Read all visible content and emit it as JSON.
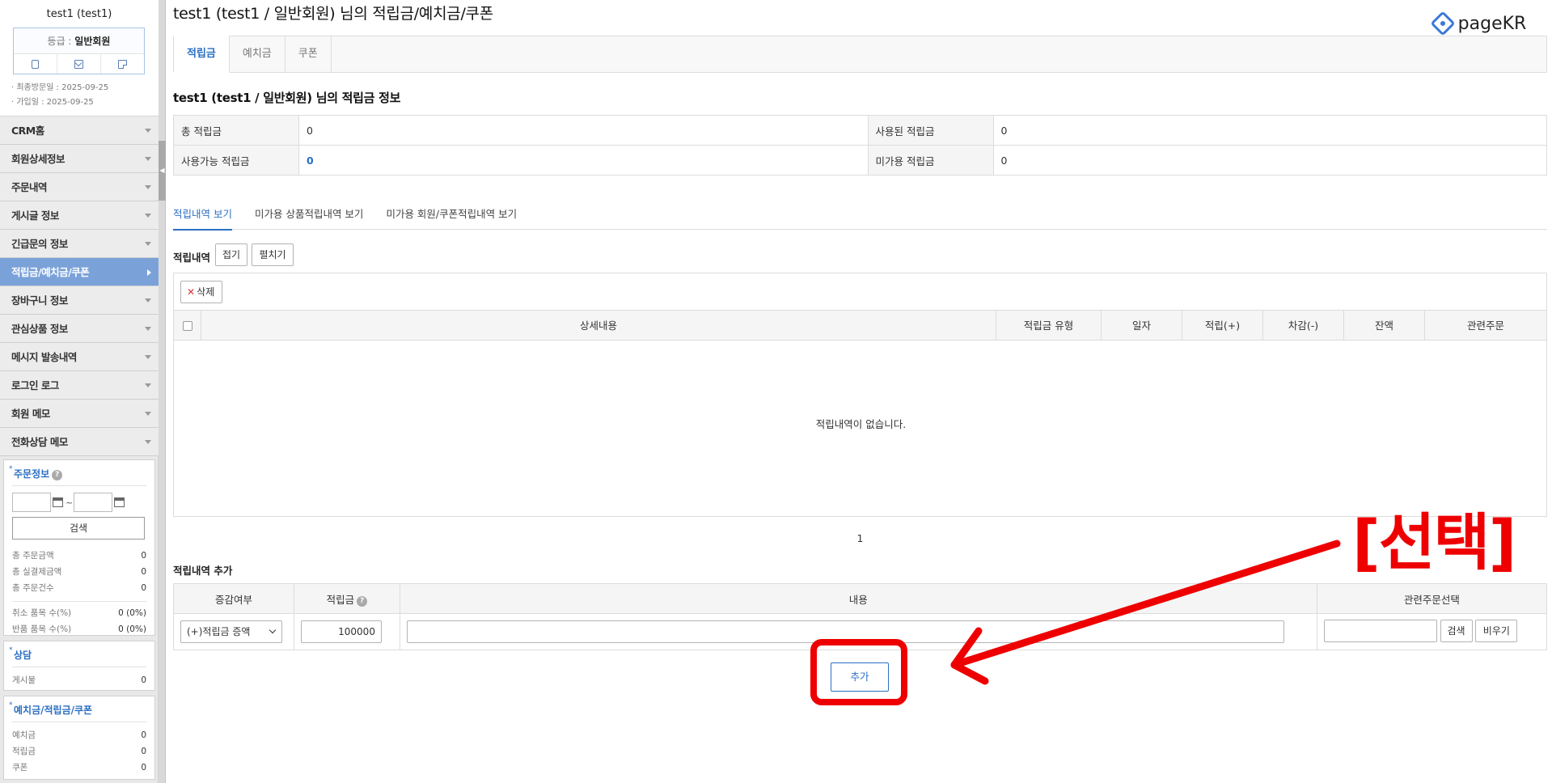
{
  "profile": {
    "name": "test1 (test1)",
    "grade_label": "등급 : ",
    "grade_value": "일반회원",
    "last_visit": "· 최종방문일 : 2025-09-25",
    "join_date": "· 가입일 : 2025-09-25"
  },
  "menu": {
    "items": [
      {
        "label": "CRM홈"
      },
      {
        "label": "회원상세정보"
      },
      {
        "label": "주문내역"
      },
      {
        "label": "게시글 정보"
      },
      {
        "label": "긴급문의 정보"
      },
      {
        "label": "적립금/예치금/쿠폰"
      },
      {
        "label": "장바구니 정보"
      },
      {
        "label": "관심상품 정보"
      },
      {
        "label": "메시지 발송내역"
      },
      {
        "label": "로그인 로그"
      },
      {
        "label": "회원 메모"
      },
      {
        "label": "전화상담 메모"
      }
    ],
    "active_index": 5
  },
  "order_panel": {
    "title": "주문정보",
    "date_sep": "~",
    "search_label": "검색",
    "stats": [
      {
        "label": "총 주문금액",
        "value": "0"
      },
      {
        "label": "총 실결제금액",
        "value": "0"
      },
      {
        "label": "총 주문건수",
        "value": "0"
      }
    ],
    "stats2": [
      {
        "label": "취소 품목 수(%)",
        "value": "0 (0%)"
      },
      {
        "label": "반품 품목 수(%)",
        "value": "0 (0%)"
      }
    ]
  },
  "consult_panel": {
    "title": "상담",
    "stats": [
      {
        "label": "게시물",
        "value": "0"
      }
    ]
  },
  "deposit_panel": {
    "title": "예치금/적립금/쿠폰",
    "stats": [
      {
        "label": "예치금",
        "value": "0"
      },
      {
        "label": "적립금",
        "value": "0"
      },
      {
        "label": "쿠폰",
        "value": "0"
      }
    ]
  },
  "header": {
    "title": "test1 (test1 / 일반회원) 님의 적립금/예치금/쿠폰",
    "logo_text": "pageKR"
  },
  "top_tabs": [
    "적립금",
    "예치금",
    "쿠폰"
  ],
  "info": {
    "title": "test1 (test1 / 일반회원) 님의 적립금 정보",
    "total_label": "총 적립금",
    "total_value": "0",
    "used_label": "사용된 적립금",
    "used_value": "0",
    "available_label": "사용가능 적립금",
    "available_value": "0",
    "unavailable_label": "미가용 적립금",
    "unavailable_value": "0"
  },
  "sub_tabs": [
    "적립내역 보기",
    "미가용 상품적립내역 보기",
    "미가용 회원/쿠폰적립내역 보기"
  ],
  "history": {
    "title": "적립내역",
    "collapse_label": "접기",
    "expand_label": "펼치기",
    "delete_label": "삭제",
    "columns": [
      "상세내용",
      "적립금 유형",
      "일자",
      "적립(+)",
      "차감(-)",
      "잔액",
      "관련주문"
    ],
    "empty_message": "적립내역이 없습니다.",
    "page": "1"
  },
  "add": {
    "title": "적립내역 추가",
    "columns": [
      "증감여부",
      "적립금",
      "내용",
      "관련주문선택"
    ],
    "type_value": "(+)적립금 증액",
    "amount_value": "100000",
    "search_label": "검색",
    "clear_label": "비우기",
    "submit_label": "추가"
  },
  "annotation": {
    "text": "[선택]",
    "color": "#ee0000"
  },
  "colors": {
    "accent": "#2b6fc3",
    "sidebar_active": "#7aa2d9"
  }
}
